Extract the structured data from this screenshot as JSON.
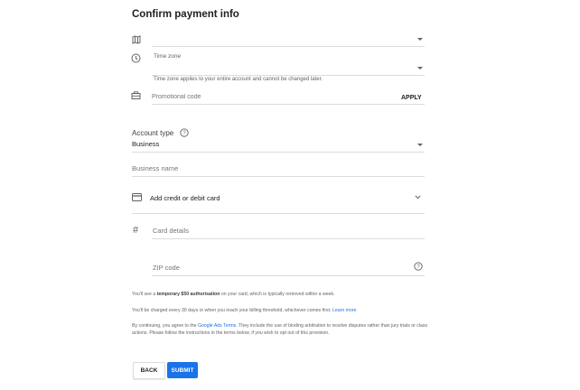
{
  "page": {
    "title": "Confirm payment info"
  },
  "country": {
    "value": ""
  },
  "timezone": {
    "label": "Time zone",
    "value": "",
    "helper": "Time zone applies to your entire account and cannot be changed later."
  },
  "promo": {
    "placeholder": "Promotional code",
    "apply_label": "APPLY"
  },
  "account_type": {
    "label": "Account type",
    "help_icon": "help-circle-icon",
    "value": "Business"
  },
  "business_name": {
    "placeholder": "Business name"
  },
  "payment": {
    "add_card_label": "Add credit or debit card",
    "card_details_placeholder": "Card details",
    "zip_placeholder": "ZIP code"
  },
  "notes": {
    "auth_pre": "You'll see a ",
    "auth_bold": "temporary $50 authorisation",
    "auth_post": " on your card, which is typically removed within a week.",
    "billing_pre": "You'll be charged every 30 days or when you reach your billing threshold, whichever comes first. ",
    "billing_link": "Learn more",
    "terms_pre": "By continuing, you agree to the ",
    "terms_link": "Google Ads Terms",
    "terms_post": ". They include the use of binding arbitration to resolve disputes rather than jury trials or class actions. Please follow the instructions in the terms below, if you wish to opt out of this provision."
  },
  "buttons": {
    "back_label": "BACK",
    "submit_label": "SUBMIT"
  },
  "colors": {
    "primary": "#1a73e8",
    "divider": "#dadce0",
    "text": "#202124",
    "muted": "#5f6368"
  }
}
